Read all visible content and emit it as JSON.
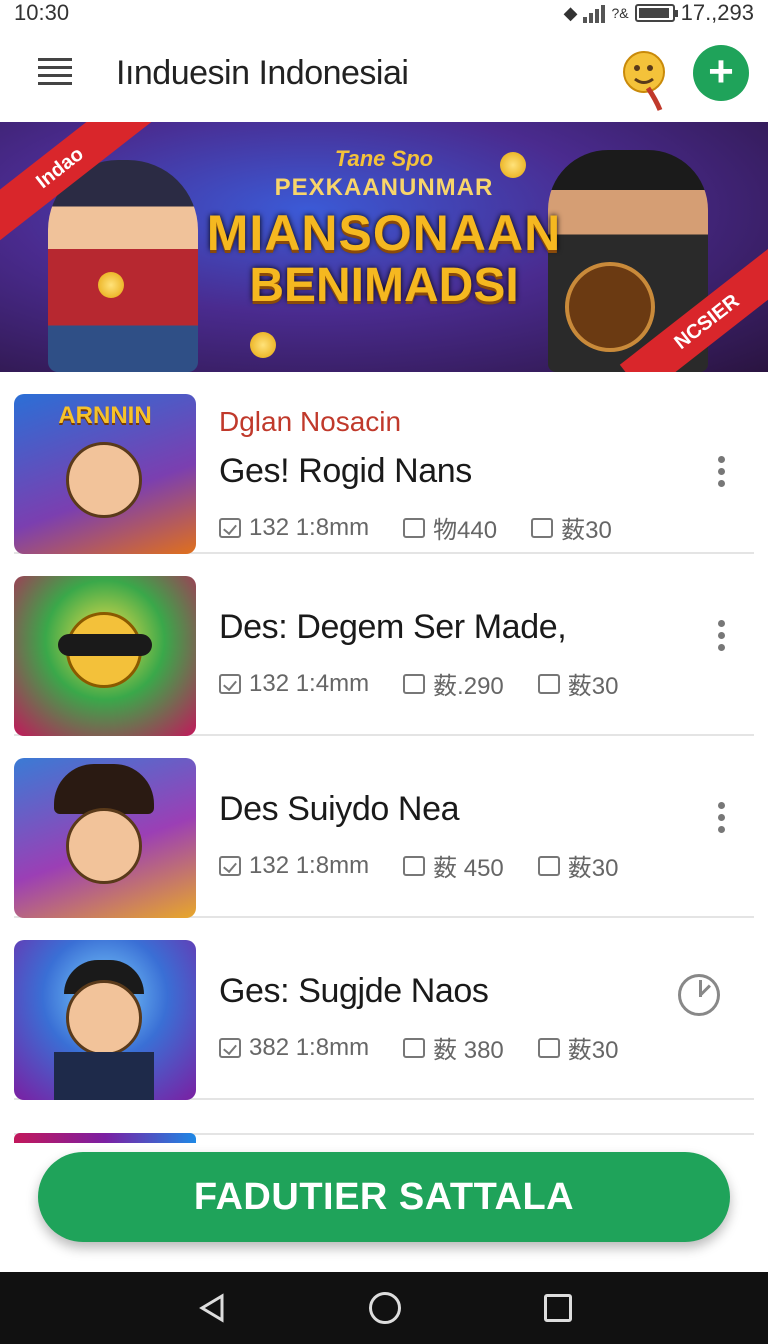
{
  "status_bar": {
    "time": "10:30",
    "battery_text": "17.,293",
    "signal_text": "?&"
  },
  "app_bar": {
    "title": "Iınduesin Indonesiai",
    "add_symbol": "+"
  },
  "banner": {
    "ribbon_left": "Indao",
    "ribbon_right": "NCSIER",
    "subtitle_1": "Tane Spo",
    "subtitle_2": "PEXKAANUNMAR",
    "headline_1": "MIANSONAAN",
    "headline_2": "BENIMADSI"
  },
  "list": {
    "items": [
      {
        "category": "Dglan Nosacin",
        "title": "Ges! Rogid Nans",
        "thumb_logo": "ARNNIN",
        "meta": [
          "132 1:8mm",
          "物440",
          "薮30"
        ],
        "action": "more"
      },
      {
        "category": "",
        "title": "Des: Degem Ser Made,",
        "thumb_logo": "",
        "meta": [
          "132 1:4mm",
          "薮.290",
          "薮30"
        ],
        "action": "more"
      },
      {
        "category": "",
        "title": "Des Suiydo Nea",
        "thumb_logo": "",
        "meta": [
          "132 1:8mm",
          "薮 450",
          "薮30"
        ],
        "action": "more"
      },
      {
        "category": "",
        "title": "Ges: Sugjde Naos",
        "thumb_logo": "",
        "meta": [
          "382 1:8mm",
          "薮 380",
          "薮30"
        ],
        "action": "timer"
      }
    ]
  },
  "cta": {
    "label": "FADUTIER SATTALA"
  },
  "colors": {
    "accent": "#1fa35a",
    "category_red": "#c0392b",
    "banner_ribbon": "#d9262b"
  }
}
